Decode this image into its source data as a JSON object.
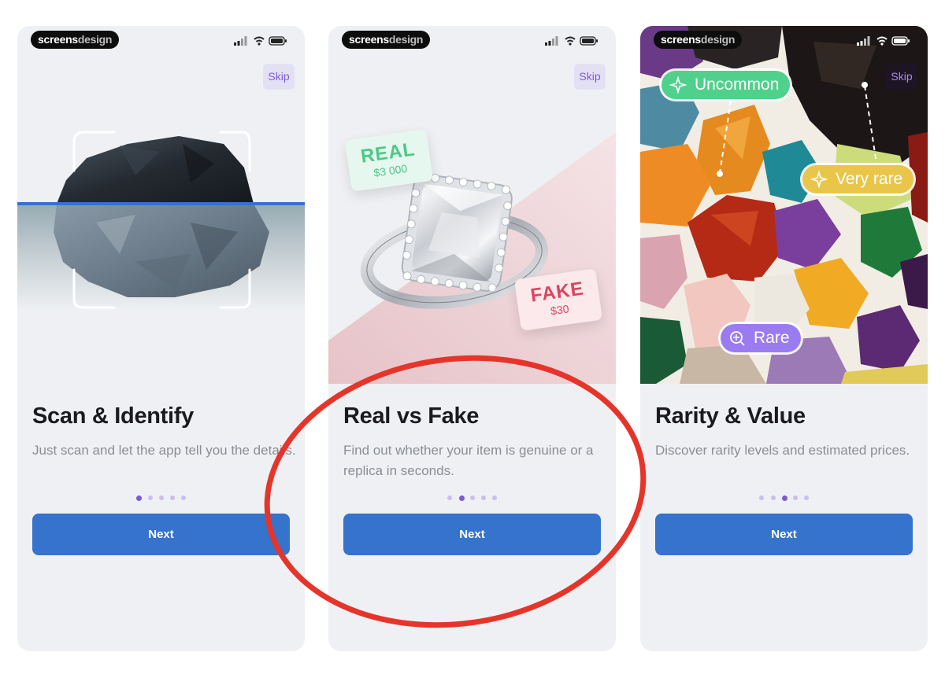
{
  "brand": {
    "part1": "screens",
    "part2": "design"
  },
  "screens": [
    {
      "skip_label": "Skip",
      "title": "Scan & Identify",
      "description": "Just scan and let the app tell you the details.",
      "next_label": "Next",
      "page_index": 0,
      "page_count": 5
    },
    {
      "skip_label": "Skip",
      "title": "Real vs Fake",
      "description": "Find out whether your item is genuine or a replica in seconds.",
      "next_label": "Next",
      "page_index": 1,
      "page_count": 5,
      "real_card": {
        "label": "REAL",
        "price": "$3 000"
      },
      "fake_card": {
        "label": "FAKE",
        "price": "$30"
      }
    },
    {
      "skip_label": "Skip",
      "title": "Rarity & Value",
      "description": "Discover rarity levels and estimated prices.",
      "next_label": "Next",
      "page_index": 2,
      "page_count": 5,
      "tags": {
        "uncommon": "Uncommon",
        "very_rare": "Very rare",
        "rare": "Rare"
      }
    }
  ],
  "colors": {
    "primary_button": "#3573cc",
    "accent_purple": "#7b5bd4",
    "dot_inactive": "#cbbdf0",
    "highlight_ring": "#e5352a",
    "tag_uncommon": "#4fd18b",
    "tag_very_rare": "#e9c64a",
    "tag_rare": "#9b7cf0"
  },
  "icons": [
    "signal-icon",
    "wifi-icon",
    "battery-icon",
    "scan-frame-icon",
    "sparkle-icon",
    "magnifier-icon"
  ]
}
